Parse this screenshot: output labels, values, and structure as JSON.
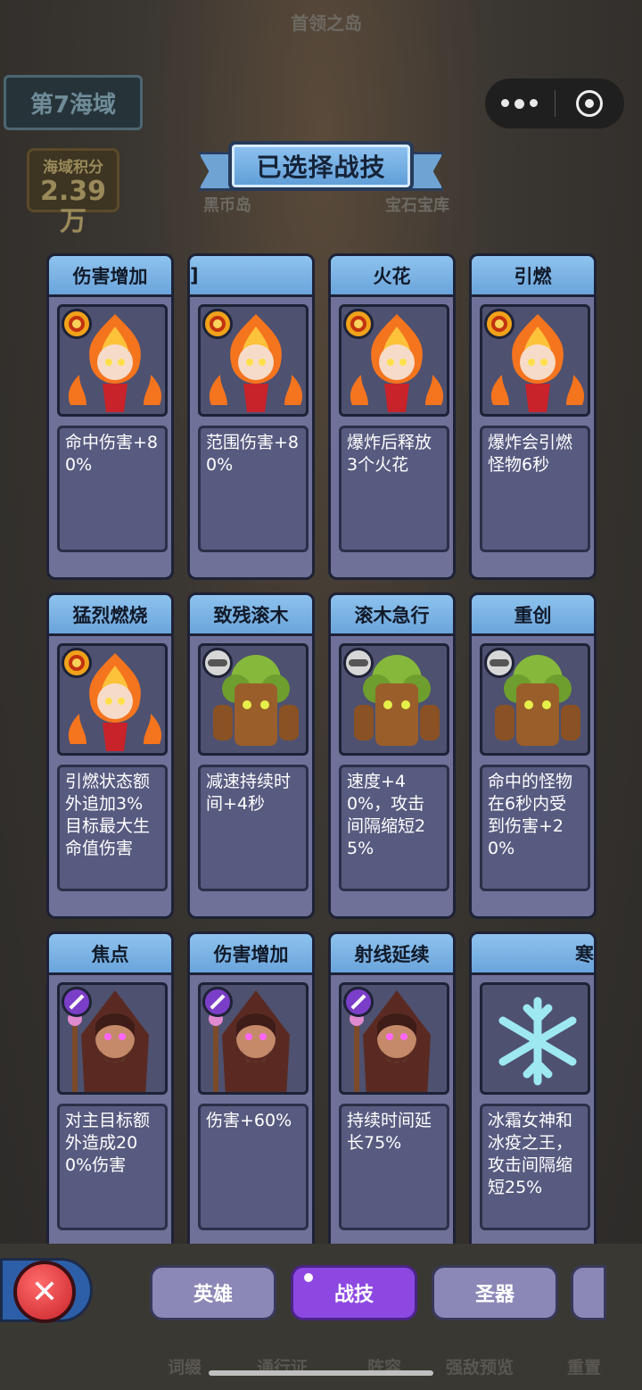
{
  "background": {
    "boss_island": "首领之岛",
    "coin_island": "黑币岛",
    "gem_vault": "宝石宝库",
    "region_name": "第7海域",
    "score_label": "海域积分",
    "score_value": "2.39万"
  },
  "header": {
    "title": "已选择战技"
  },
  "cards": [
    {
      "title": "伤害增加",
      "desc": "命中伤害+80%",
      "badge": "fire-badge",
      "hero": "fire-spirit"
    },
    {
      "title": "]",
      "desc": "范围伤害+80%",
      "badge": "fire-badge",
      "hero": "fire-spirit"
    },
    {
      "title": "火花",
      "desc": "爆炸后释放3个火花",
      "badge": "fire-badge",
      "hero": "fire-spirit"
    },
    {
      "title": "引燃",
      "desc": "爆炸会引燃怪物6秒",
      "badge": "fire-badge",
      "hero": "fire-spirit"
    },
    {
      "title": "猛烈燃烧",
      "desc": "引燃状态额外追加3%目标最大生命值伤害",
      "badge": "fire-badge",
      "hero": "fire-spirit"
    },
    {
      "title": "致残滚木",
      "desc": "减速持续时间+4秒",
      "badge": "wood-badge",
      "hero": "tree-golem"
    },
    {
      "title": "滚木急行",
      "desc": "速度+40%，攻击间隔缩短25%",
      "badge": "wood-badge",
      "hero": "tree-golem"
    },
    {
      "title": "重创",
      "desc": "命中的怪物在6秒内受到伤害+20%",
      "badge": "wood-badge",
      "hero": "tree-golem"
    },
    {
      "title": "焦点",
      "desc": "对主目标额外造成200%伤害",
      "badge": "arcane-badge",
      "hero": "hooded-mage"
    },
    {
      "title": "伤害增加",
      "desc": "伤害+60%",
      "badge": "arcane-badge",
      "hero": "hooded-mage"
    },
    {
      "title": "射线延续",
      "desc": "持续时间延长75%",
      "badge": "arcane-badge",
      "hero": "hooded-mage"
    },
    {
      "title": "寒",
      "desc": "冰霜女神和冰疫之王，攻击间隔缩短25%",
      "badge": "",
      "hero": "snowflake"
    }
  ],
  "tabs": [
    {
      "label": "英雄",
      "active": false
    },
    {
      "label": "战技",
      "active": true
    },
    {
      "label": "圣器",
      "active": false
    }
  ],
  "bottom_nav": {
    "items": [
      "词缀",
      "通行证",
      "阵容",
      "强敌预览",
      "重置"
    ]
  },
  "close_label": "✕"
}
